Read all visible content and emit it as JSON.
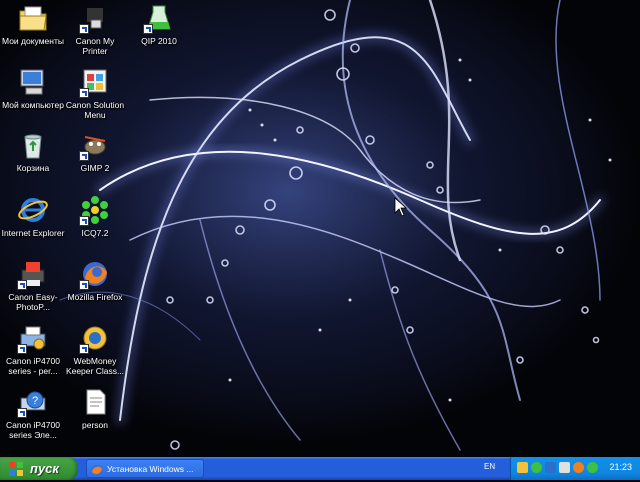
{
  "desktop": {
    "icons": [
      {
        "label": "Мои документы",
        "icon": "my-documents-icon"
      },
      {
        "label": "Мой компьютер",
        "icon": "my-computer-icon"
      },
      {
        "label": "Корзина",
        "icon": "recycle-bin-icon"
      },
      {
        "label": "Internet Explorer",
        "icon": "internet-explorer-icon"
      },
      {
        "label": "Canon Easy-PhotoP...",
        "icon": "canon-easy-photoprint-icon"
      },
      {
        "label": "Canon iP4700 series - per...",
        "icon": "printer-icon"
      },
      {
        "label": "Canon iP4700 series Эле...",
        "icon": "printer-help-icon"
      },
      {
        "label": "Canon My Printer",
        "icon": "canon-my-printer-icon"
      },
      {
        "label": "Canon Solution Menu",
        "icon": "canon-solution-menu-icon"
      },
      {
        "label": "GIMP 2",
        "icon": "gimp-icon"
      },
      {
        "label": "ICQ7.2",
        "icon": "icq-icon"
      },
      {
        "label": "Mozilla Firefox",
        "icon": "firefox-icon"
      },
      {
        "label": "WebMoney Keeper Class...",
        "icon": "webmoney-icon"
      },
      {
        "label": "person",
        "icon": "document-icon"
      },
      {
        "label": "QIP 2010",
        "icon": "qip-icon"
      }
    ]
  },
  "taskbar": {
    "start_label": "пуск",
    "task_label": "Установка Windows ...",
    "language": "EN",
    "clock": "21:23"
  },
  "colors": {
    "taskbar_blue": "#245edb",
    "start_green": "#3c9a3c",
    "tray_blue": "#0f86e0"
  }
}
